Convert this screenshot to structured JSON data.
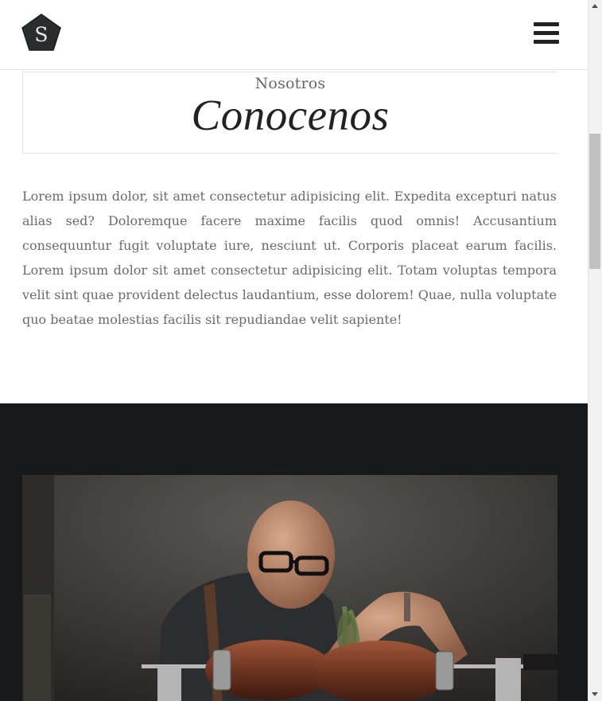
{
  "header": {
    "logo_letter": "S",
    "menu_icon": "hamburger-menu-icon"
  },
  "about": {
    "subtitle": "Nosotros",
    "title": "Conocenos",
    "body": "Lorem ipsum dolor, sit amet consectetur adipisicing elit. Expedita excepturi natus alias sed? Doloremque facere maxime facilis quod omnis! Accusantium consequuntur fugit voluptate iure, nesciunt ut. Corporis placeat earum facilis. Lorem ipsum dolor sit amet consectetur adipisicing elit. Totam voluptas tempora velit sint quae provident delectus laudantium, esse dolorem! Quae, nulla voluptate quo beatae molestias facilis sit repudiandae velit sapiente!"
  },
  "colors": {
    "dark_section_bg": "#18191b",
    "logo_bg": "#2b2c2e",
    "text_muted": "#6a6a6a"
  }
}
